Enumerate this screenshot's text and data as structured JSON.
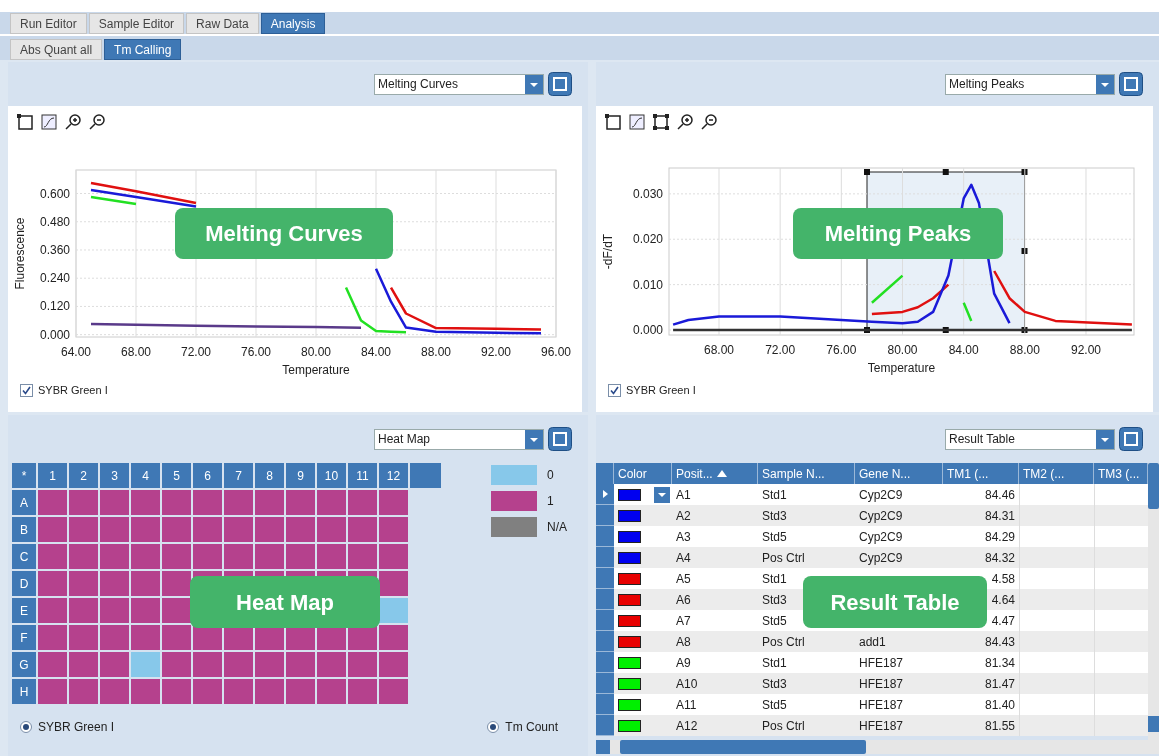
{
  "tabs": [
    {
      "label": "Run Editor",
      "selected": false
    },
    {
      "label": "Sample Editor",
      "selected": false
    },
    {
      "label": "Raw Data",
      "selected": false
    },
    {
      "label": "Analysis",
      "selected": true
    }
  ],
  "subtabs": [
    {
      "label": "Abs Quant all",
      "selected": false
    },
    {
      "label": "Tm Calling",
      "selected": true
    }
  ],
  "melting_curves": {
    "view": "Melting Curves",
    "callout": "Melting Curves",
    "checkbox": {
      "label": "SYBR Green I",
      "checked": true
    },
    "chart_data": {
      "type": "line",
      "grid": true,
      "xlabel": "Temperature",
      "ylabel": "Fluorescence",
      "xlim": [
        64,
        96
      ],
      "ylim": [
        -0.01,
        0.7
      ],
      "xticks": [
        {
          "value": 64,
          "label": "64.00"
        },
        {
          "value": 68,
          "label": "68.00"
        },
        {
          "value": 72,
          "label": "72.00"
        },
        {
          "value": 76,
          "label": "76.00"
        },
        {
          "value": 80,
          "label": "80.00"
        },
        {
          "value": 84,
          "label": "84.00"
        },
        {
          "value": 88,
          "label": "88.00"
        },
        {
          "value": 92,
          "label": "92.00"
        },
        {
          "value": 96,
          "label": "96.00"
        }
      ],
      "yticks": [
        {
          "value": 0,
          "label": "0.000"
        },
        {
          "value": 0.12,
          "label": "0.120"
        },
        {
          "value": 0.24,
          "label": "0.240"
        },
        {
          "value": 0.36,
          "label": "0.360"
        },
        {
          "value": 0.48,
          "label": "0.480"
        },
        {
          "value": 0.6,
          "label": "0.600"
        }
      ],
      "x": [
        65,
        68,
        72,
        76,
        80,
        82,
        83,
        84,
        85,
        86,
        88,
        92,
        95
      ],
      "series": [
        {
          "color": "#e01010",
          "values": [
            0.645,
            0.61,
            0.56,
            null,
            null,
            null,
            null,
            null,
            0.2,
            0.09,
            0.028,
            0.025,
            0.022
          ]
        },
        {
          "color": "#1a1ad8",
          "values": [
            0.615,
            0.585,
            0.545,
            null,
            null,
            null,
            null,
            0.28,
            0.14,
            0.03,
            0.012,
            0.008,
            0.006
          ]
        },
        {
          "color": "#22e022",
          "values": [
            0.585,
            0.555,
            null,
            null,
            null,
            0.2,
            0.06,
            0.015,
            0.012,
            0.01,
            null,
            null,
            null
          ]
        },
        {
          "color": "#5a3a8a",
          "values": [
            0.045,
            0.042,
            0.038,
            0.035,
            0.032,
            0.03,
            0.029,
            null,
            null,
            null,
            null,
            null,
            null
          ]
        }
      ]
    }
  },
  "melting_peaks": {
    "view": "Melting Peaks",
    "callout": "Melting Peaks",
    "checkbox": {
      "label": "SYBR Green I",
      "checked": true
    },
    "chart_data": {
      "type": "line",
      "grid": true,
      "xlabel": "Temperature",
      "ylabel": "-dF/dT",
      "xlim": [
        64.73,
        95.14
      ],
      "ylim": [
        -0.0011,
        0.0357
      ],
      "xticks": [
        {
          "value": 68,
          "label": "68.00"
        },
        {
          "value": 72,
          "label": "72.00"
        },
        {
          "value": 76,
          "label": "76.00"
        },
        {
          "value": 80,
          "label": "80.00"
        },
        {
          "value": 84,
          "label": "84.00"
        },
        {
          "value": 88,
          "label": "88.00"
        },
        {
          "value": 92,
          "label": "92.00"
        }
      ],
      "yticks": [
        {
          "value": 0,
          "label": "0.000"
        },
        {
          "value": 0.01,
          "label": "0.010"
        },
        {
          "value": 0.02,
          "label": "0.020"
        },
        {
          "value": 0.03,
          "label": "0.030"
        }
      ],
      "x": [
        65,
        66,
        68,
        72,
        76,
        78,
        80,
        81,
        82,
        83,
        84,
        84.5,
        85,
        86,
        87,
        88,
        90,
        95
      ],
      "series": [
        {
          "color": "#333333",
          "values": [
            0,
            0,
            0,
            0,
            0,
            0,
            0,
            0,
            0,
            0,
            0,
            0,
            0,
            0,
            0,
            0,
            0,
            0
          ]
        },
        {
          "color": "#22e022",
          "values": [
            null,
            null,
            null,
            null,
            null,
            0.006,
            0.012,
            null,
            null,
            null,
            0.006,
            0.002,
            null,
            null,
            null,
            null,
            null,
            null
          ]
        },
        {
          "color": "#e01010",
          "values": [
            null,
            null,
            null,
            null,
            null,
            0.0035,
            0.004,
            0.005,
            0.007,
            0.01,
            null,
            null,
            null,
            0.013,
            0.007,
            0.004,
            0.002,
            0.0012
          ]
        },
        {
          "color": "#1a1ad8",
          "values": [
            0.0012,
            0.0022,
            0.003,
            0.003,
            0.0022,
            0.0018,
            0.0015,
            0.0018,
            0.004,
            0.012,
            0.029,
            0.032,
            0.028,
            0.008,
            0.0015,
            null,
            null,
            null
          ]
        }
      ]
    }
  },
  "heat_map": {
    "view": "Heat Map",
    "callout": "Heat Map",
    "corner": "*",
    "columns": [
      "1",
      "2",
      "3",
      "4",
      "5",
      "6",
      "7",
      "8",
      "9",
      "10",
      "11",
      "12"
    ],
    "rows": [
      {
        "label": "A",
        "cells": [
          {
            "color": "#b5418d"
          },
          {
            "color": "#b5418d"
          },
          {
            "color": "#b5418d"
          },
          {
            "color": "#b5418d"
          },
          {
            "color": "#b5418d"
          },
          {
            "color": "#b5418d"
          },
          {
            "color": "#b5418d"
          },
          {
            "color": "#b5418d"
          },
          {
            "color": "#b5418d"
          },
          {
            "color": "#b5418d"
          },
          {
            "color": "#b5418d"
          },
          {
            "color": "#b5418d"
          }
        ]
      },
      {
        "label": "B",
        "cells": [
          {
            "color": "#b5418d"
          },
          {
            "color": "#b5418d"
          },
          {
            "color": "#b5418d"
          },
          {
            "color": "#b5418d"
          },
          {
            "color": "#b5418d"
          },
          {
            "color": "#b5418d"
          },
          {
            "color": "#b5418d"
          },
          {
            "color": "#b5418d"
          },
          {
            "color": "#b5418d"
          },
          {
            "color": "#b5418d"
          },
          {
            "color": "#b5418d"
          },
          {
            "color": "#b5418d"
          }
        ]
      },
      {
        "label": "C",
        "cells": [
          {
            "color": "#b5418d"
          },
          {
            "color": "#b5418d"
          },
          {
            "color": "#b5418d"
          },
          {
            "color": "#b5418d"
          },
          {
            "color": "#b5418d"
          },
          {
            "color": "#b5418d"
          },
          {
            "color": "#b5418d"
          },
          {
            "color": "#b5418d"
          },
          {
            "color": "#b5418d"
          },
          {
            "color": "#b5418d"
          },
          {
            "color": "#b5418d"
          },
          {
            "color": "#b5418d"
          }
        ]
      },
      {
        "label": "D",
        "cells": [
          {
            "color": "#b5418d"
          },
          {
            "color": "#b5418d"
          },
          {
            "color": "#b5418d"
          },
          {
            "color": "#b5418d"
          },
          {
            "color": "#b5418d"
          },
          {
            "color": "#b5418d"
          },
          {
            "color": "#b5418d"
          },
          {
            "color": "#b5418d"
          },
          {
            "color": "#b5418d"
          },
          {
            "color": "#b5418d"
          },
          {
            "color": "#b5418d"
          },
          {
            "color": "#b5418d"
          }
        ]
      },
      {
        "label": "E",
        "cells": [
          {
            "color": "#b5418d"
          },
          {
            "color": "#b5418d"
          },
          {
            "color": "#b5418d"
          },
          {
            "color": "#b5418d"
          },
          {
            "color": "#b5418d"
          },
          null,
          null,
          null,
          null,
          null,
          null,
          {
            "color": "#87c8ea"
          }
        ]
      },
      {
        "label": "F",
        "cells": [
          {
            "color": "#b5418d"
          },
          {
            "color": "#b5418d"
          },
          {
            "color": "#b5418d"
          },
          {
            "color": "#b5418d"
          },
          {
            "color": "#b5418d"
          },
          {
            "color": "#b5418d"
          },
          {
            "color": "#b5418d"
          },
          {
            "color": "#b5418d"
          },
          {
            "color": "#b5418d"
          },
          {
            "color": "#b5418d"
          },
          {
            "color": "#b5418d"
          },
          {
            "color": "#b5418d"
          }
        ]
      },
      {
        "label": "G",
        "cells": [
          {
            "color": "#b5418d"
          },
          {
            "color": "#b5418d"
          },
          {
            "color": "#b5418d"
          },
          {
            "color": "#87c8ea"
          },
          {
            "color": "#b5418d"
          },
          {
            "color": "#b5418d"
          },
          {
            "color": "#b5418d"
          },
          {
            "color": "#b5418d"
          },
          {
            "color": "#b5418d"
          },
          {
            "color": "#b5418d"
          },
          {
            "color": "#b5418d"
          },
          {
            "color": "#b5418d"
          }
        ]
      },
      {
        "label": "H",
        "cells": [
          {
            "color": "#b5418d"
          },
          {
            "color": "#b5418d"
          },
          {
            "color": "#b5418d"
          },
          {
            "color": "#b5418d"
          },
          {
            "color": "#b5418d"
          },
          {
            "color": "#b5418d"
          },
          {
            "color": "#b5418d"
          },
          {
            "color": "#b5418d"
          },
          {
            "color": "#b5418d"
          },
          {
            "color": "#b5418d"
          },
          {
            "color": "#b5418d"
          },
          {
            "color": "#b5418d"
          }
        ]
      }
    ],
    "legend": [
      {
        "label": "0",
        "color": "#87c8ea"
      },
      {
        "label": "1",
        "color": "#b5418d"
      },
      {
        "label": "N/A",
        "color": "#808080"
      }
    ],
    "options": [
      {
        "label": "SYBR Green I",
        "selected": true
      },
      {
        "label": "Tm Count",
        "selected": true
      }
    ]
  },
  "result_table": {
    "view": "Result Table",
    "callout": "Result Table",
    "columns": [
      "Color",
      "Posit...",
      "Sample N...",
      "Gene N...",
      "TM1 (...",
      "TM2 (...",
      "TM3 (..."
    ],
    "rows": [
      {
        "color": "#0000f0",
        "position": "A1",
        "sample": "Std1",
        "gene": "Cyp2C9",
        "tm1": "84.46",
        "selected": true
      },
      {
        "color": "#0000f0",
        "position": "A2",
        "sample": "Std3",
        "gene": "Cyp2C9",
        "tm1": "84.31",
        "selected": false
      },
      {
        "color": "#0000f0",
        "position": "A3",
        "sample": "Std5",
        "gene": "Cyp2C9",
        "tm1": "84.29",
        "selected": false
      },
      {
        "color": "#0000f0",
        "position": "A4",
        "sample": "Pos Ctrl",
        "gene": "Cyp2C9",
        "tm1": "84.32",
        "selected": false
      },
      {
        "color": "#e80000",
        "position": "A5",
        "sample": "Std1",
        "tm1": "4.58",
        "selected": false
      },
      {
        "color": "#e80000",
        "position": "A6",
        "sample": "Std3",
        "tm1": "4.64",
        "selected": false
      },
      {
        "color": "#e80000",
        "position": "A7",
        "sample": "Std5",
        "tm1": "4.47",
        "selected": false
      },
      {
        "color": "#e80000",
        "position": "A8",
        "sample": "Pos Ctrl",
        "gene": "add1",
        "tm1": "84.43",
        "selected": false
      },
      {
        "color": "#00f000",
        "position": "A9",
        "sample": "Std1",
        "gene": "HFE187",
        "tm1": "81.34",
        "selected": false
      },
      {
        "color": "#00f000",
        "position": "A10",
        "sample": "Std3",
        "gene": "HFE187",
        "tm1": "81.47",
        "selected": false
      },
      {
        "color": "#00f000",
        "position": "A11",
        "sample": "Std5",
        "gene": "HFE187",
        "tm1": "81.40",
        "selected": false
      },
      {
        "color": "#00f000",
        "position": "A12",
        "sample": "Pos Ctrl",
        "gene": "HFE187",
        "tm1": "81.55",
        "selected": false
      }
    ]
  }
}
